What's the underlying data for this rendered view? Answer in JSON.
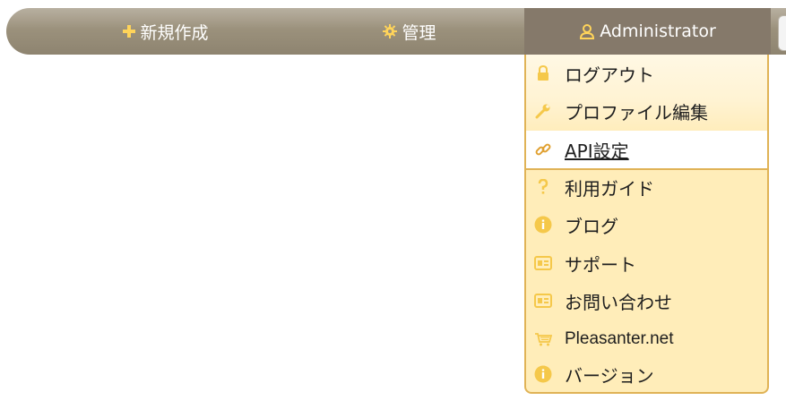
{
  "navbar": {
    "new_label": "新規作成",
    "admin_label": "管理",
    "user_label": "Administrator"
  },
  "dropdown": {
    "items": [
      {
        "label": "ログアウト",
        "icon": "lock-icon"
      },
      {
        "label": "プロファイル編集",
        "icon": "wrench-icon"
      },
      {
        "label": "API設定",
        "icon": "link-icon"
      },
      {
        "label": "利用ガイド",
        "icon": "question-icon"
      },
      {
        "label": "ブログ",
        "icon": "info-icon"
      },
      {
        "label": "サポート",
        "icon": "card-icon"
      },
      {
        "label": "お問い合わせ",
        "icon": "card-icon"
      },
      {
        "label": "Pleasanter.net",
        "icon": "cart-icon"
      },
      {
        "label": "バージョン",
        "icon": "info-icon"
      }
    ]
  },
  "colors": {
    "navbar": "#9b917c",
    "navbar_active": "#85796a",
    "dropdown_bg": "#ffedb9",
    "dropdown_border": "#e0b356",
    "icon_yellow": "#f5c84a"
  }
}
